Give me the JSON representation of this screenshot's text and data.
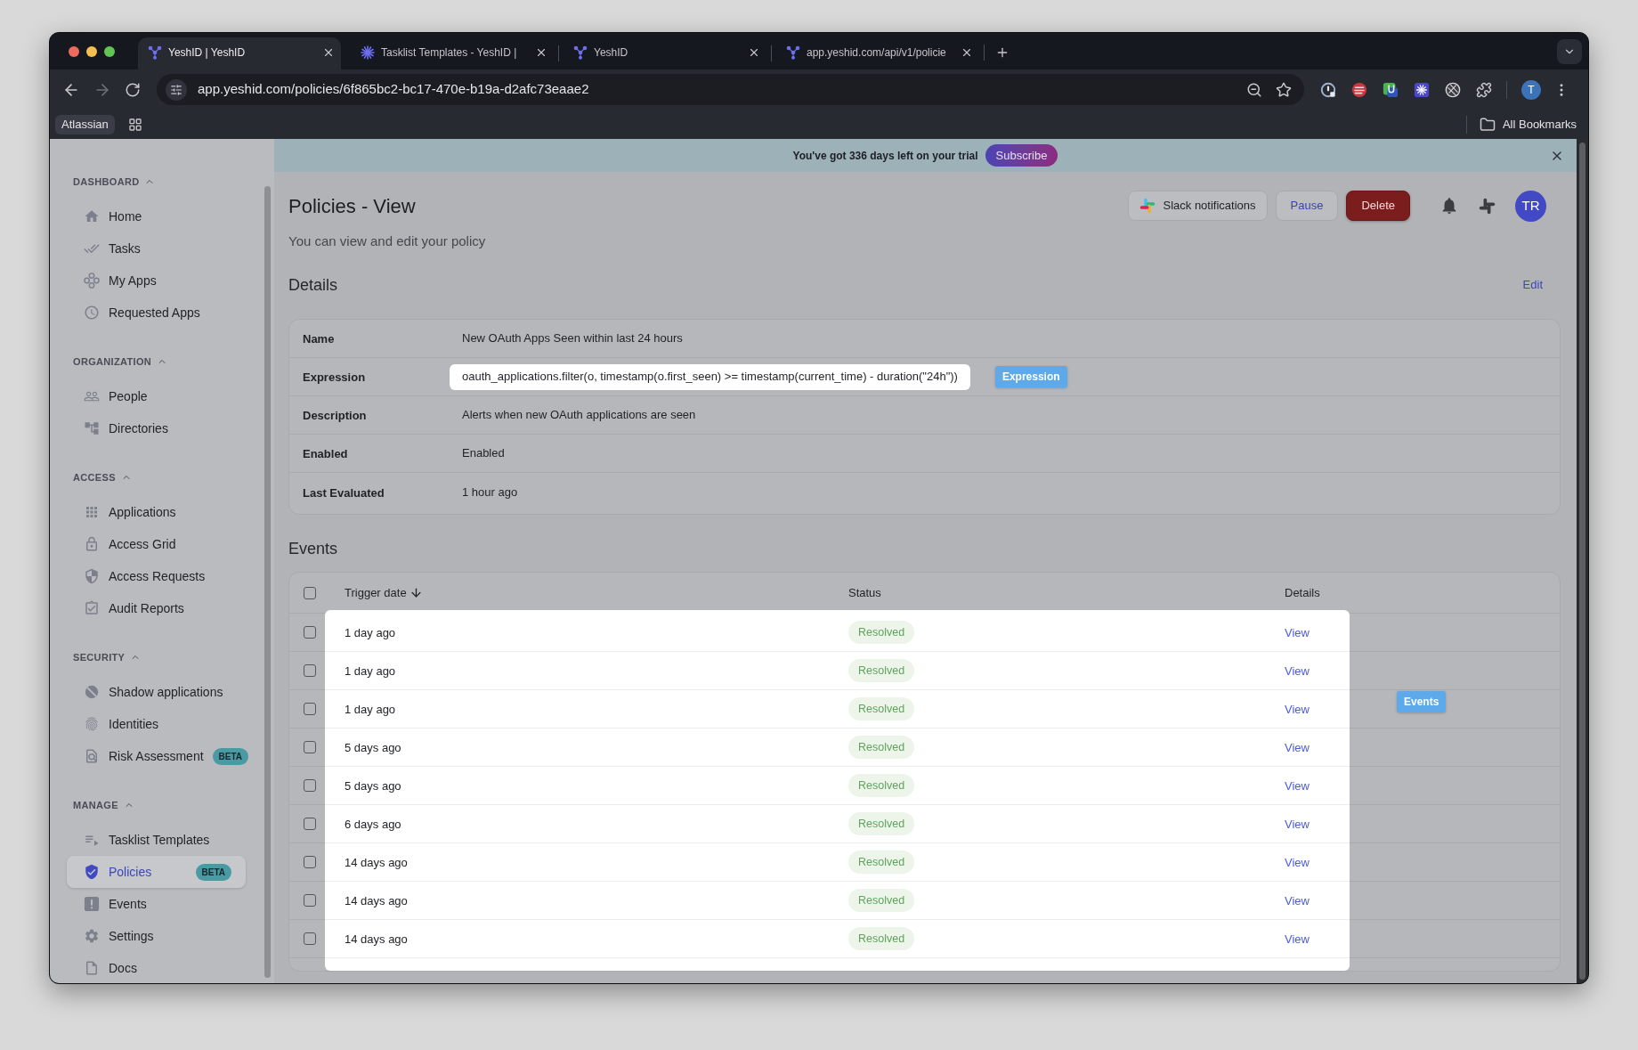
{
  "browser": {
    "tabs": [
      {
        "title": "YeshID | YeshID",
        "selected": true
      },
      {
        "title": "Tasklist Templates - YeshID |",
        "selected": false
      },
      {
        "title": "YeshID",
        "selected": false
      },
      {
        "title": "app.yeshid.com/api/v1/policie",
        "selected": false
      }
    ],
    "address": "app.yeshid.com/policies/6f865bc2-bc17-470e-b19a-d2afc73eaae2",
    "profile": "T",
    "bookmarks": [
      "Atlassian"
    ],
    "all_bookmarks": "All Bookmarks"
  },
  "trial_banner": {
    "text": "You've got 336 days left on your trial",
    "button": "Subscribe"
  },
  "sidebar": {
    "sections": [
      {
        "title": "DASHBOARD",
        "expanded": true,
        "items": [
          {
            "label": "Home",
            "selected": false
          },
          {
            "label": "Tasks",
            "selected": false
          },
          {
            "label": "My Apps",
            "selected": false
          },
          {
            "label": "Requested Apps",
            "selected": false
          }
        ]
      },
      {
        "title": "ORGANIZATION",
        "expanded": true,
        "items": [
          {
            "label": "People",
            "selected": false
          },
          {
            "label": "Directories",
            "selected": false
          }
        ]
      },
      {
        "title": "ACCESS",
        "expanded": true,
        "items": [
          {
            "label": "Applications",
            "selected": false
          },
          {
            "label": "Access Grid",
            "selected": false
          },
          {
            "label": "Access Requests",
            "selected": false
          },
          {
            "label": "Audit Reports",
            "selected": false
          }
        ]
      },
      {
        "title": "SECURITY",
        "expanded": true,
        "items": [
          {
            "label": "Shadow applications",
            "selected": false
          },
          {
            "label": "Identities",
            "selected": false
          },
          {
            "label": "Risk Assessment",
            "selected": false,
            "badge": "BETA"
          }
        ]
      },
      {
        "title": "MANAGE",
        "expanded": true,
        "items": [
          {
            "label": "Tasklist Templates",
            "selected": false
          },
          {
            "label": "Policies",
            "selected": true,
            "badge": "BETA"
          },
          {
            "label": "Events",
            "selected": false
          },
          {
            "label": "Settings",
            "selected": false
          },
          {
            "label": "Docs",
            "selected": false
          }
        ]
      }
    ]
  },
  "header": {
    "title": "Policies - View",
    "subtitle": "You can view and edit your policy",
    "buttons": [
      {
        "label": "Slack notifications",
        "kind": "integration"
      },
      {
        "label": "Pause",
        "kind": "secondary"
      },
      {
        "label": "Delete",
        "kind": "danger"
      }
    ],
    "avatar": "TR"
  },
  "details": {
    "title": "Details",
    "action": "Edit",
    "fields": [
      {
        "label": "Name",
        "value": "New OAuth Apps Seen within last 24 hours",
        "highlighted": false
      },
      {
        "label": "Expression",
        "value": "oauth_applications.filter(o, timestamp(o.first_seen) >= timestamp(current_time) - duration(\"24h\"))",
        "highlighted": true,
        "tag": "Expression"
      },
      {
        "label": "Description",
        "value": "Alerts when new OAuth applications are seen",
        "highlighted": false
      },
      {
        "label": "Enabled",
        "value": "Enabled",
        "highlighted": false
      },
      {
        "label": "Last Evaluated",
        "value": "1 hour ago",
        "highlighted": false
      }
    ]
  },
  "events": {
    "title": "Events",
    "all_checked": false,
    "highlighted": true,
    "tag": "Events",
    "columns": [
      {
        "label": "Trigger date",
        "sorted": true
      },
      {
        "label": "Status",
        "sorted": false
      },
      {
        "label": "Details",
        "sorted": false
      }
    ],
    "rows": [
      {
        "checked": false,
        "trigger_date": "1 day ago",
        "status": "Resolved",
        "details": "View"
      },
      {
        "checked": false,
        "trigger_date": "1 day ago",
        "status": "Resolved",
        "details": "View"
      },
      {
        "checked": false,
        "trigger_date": "1 day ago",
        "status": "Resolved",
        "details": "View"
      },
      {
        "checked": false,
        "trigger_date": "5 days ago",
        "status": "Resolved",
        "details": "View"
      },
      {
        "checked": false,
        "trigger_date": "5 days ago",
        "status": "Resolved",
        "details": "View"
      },
      {
        "checked": false,
        "trigger_date": "6 days ago",
        "status": "Resolved",
        "details": "View"
      },
      {
        "checked": false,
        "trigger_date": "14 days ago",
        "status": "Resolved",
        "details": "View"
      },
      {
        "checked": false,
        "trigger_date": "14 days ago",
        "status": "Resolved",
        "details": "View"
      },
      {
        "checked": false,
        "trigger_date": "14 days ago",
        "status": "Resolved",
        "details": "View"
      }
    ]
  }
}
